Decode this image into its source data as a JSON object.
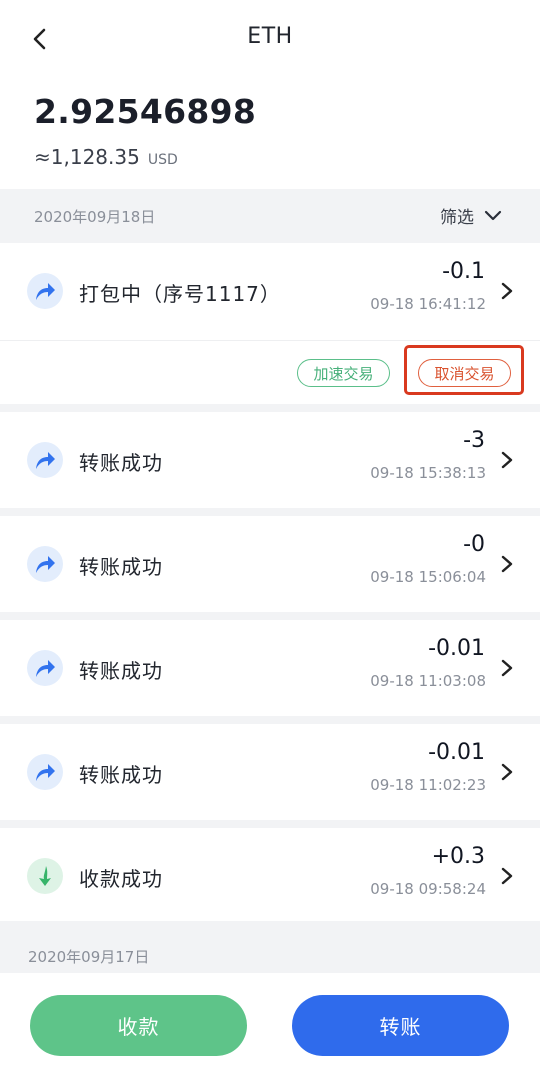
{
  "header": {
    "title": "ETH"
  },
  "balance": {
    "amount": "2.92546898",
    "fiat_value": "≈1,128.35",
    "fiat_unit": "USD"
  },
  "groups": [
    {
      "date": "2020年09月18日",
      "filter_label": "筛选"
    },
    {
      "date": "2020年09月17日"
    }
  ],
  "transactions": [
    {
      "status": "打包中（序号1117）",
      "amount": "-0.1",
      "time": "09-18 16:41:12",
      "direction": "out",
      "icon": "send-arrow-icon"
    },
    {
      "status": "转账成功",
      "amount": "-3",
      "time": "09-18 15:38:13",
      "direction": "out",
      "icon": "send-arrow-icon"
    },
    {
      "status": "转账成功",
      "amount": "-0",
      "time": "09-18 15:06:04",
      "direction": "out",
      "icon": "send-arrow-icon"
    },
    {
      "status": "转账成功",
      "amount": "-0.01",
      "time": "09-18 11:03:08",
      "direction": "out",
      "icon": "send-arrow-icon"
    },
    {
      "status": "转账成功",
      "amount": "-0.01",
      "time": "09-18 11:02:23",
      "direction": "out",
      "icon": "send-arrow-icon"
    },
    {
      "status": "收款成功",
      "amount": "+0.3",
      "time": "09-18 09:58:24",
      "direction": "in",
      "icon": "receive-arrow-icon"
    }
  ],
  "pending_actions": {
    "speed_up_label": "加速交易",
    "cancel_label": "取消交易"
  },
  "bottom": {
    "receive_label": "收款",
    "send_label": "转账"
  },
  "colors": {
    "send_button": "#2f6bec",
    "receive_button": "#5ec489",
    "highlight": "#d9391f",
    "speed_up": "#47b07a",
    "cancel": "#d9532f"
  }
}
